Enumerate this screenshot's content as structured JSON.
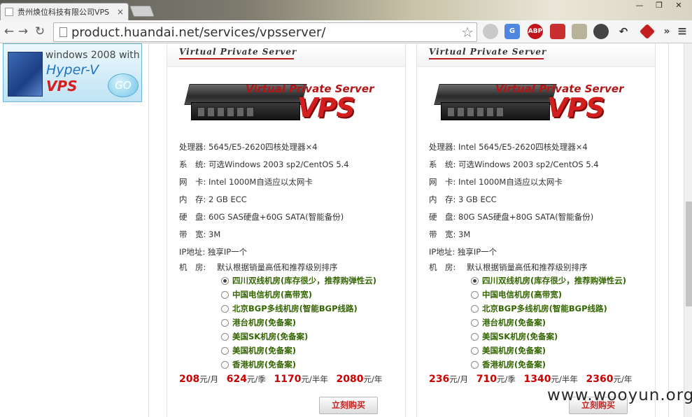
{
  "browser": {
    "tab_title": "贵州焕位科技有限公司VPS",
    "tab_close": "×",
    "url": "product.huandai.net/services/vpsserver/",
    "extensions": [
      "ABP"
    ]
  },
  "ad": {
    "line1": "windows 2008 with",
    "line2": "Hyper-V",
    "line3": "VPS",
    "go": "GO"
  },
  "cards": [
    {
      "header": "Virtual Private Server",
      "banner_text": "Virtual Private Server",
      "banner_vps": "VPS",
      "cpu": "处理器: 5645/E5-2620四核处理器×4",
      "os": "系　统: 可选Windows 2003 sp2/CentOS 5.4",
      "nic": "网　卡: Intel 1000M自适应以太网卡",
      "ram": "内　存: 2 GB ECC",
      "disk": "硬　盘: 60G SAS硬盘+60G SATA(智能备份)",
      "bandwidth": "带　宽: 3M",
      "ip": "IP地址: 独享IP一个",
      "room_label": "机　房:",
      "room_note": "默认根据销量高低和推荐级别排序",
      "rooms": [
        "四川双线机房(库存很少，推荐购弹性云)",
        "中国电信机房(高带宽)",
        "北京BGP多线机房(智能BGP线路)",
        "港台机房(免备案)",
        "美国SK机房(免备案)",
        "美国机房(免备案)",
        "香港机房(免备案)"
      ],
      "selected_room": 0,
      "prices": [
        {
          "value": "208",
          "unit": "元/月"
        },
        {
          "value": "624",
          "unit": "元/季"
        },
        {
          "value": "1170",
          "unit": "元/半年"
        },
        {
          "value": "2080",
          "unit": "元/年"
        }
      ],
      "buy_label": "立刻购买"
    },
    {
      "header": "Virtual Private Server",
      "banner_text": "Virtual Private Server",
      "banner_vps": "VPS",
      "cpu": "处理器: Intel 5645/E5-2620四核处理器×4",
      "os": "系　统: 可选Windows 2003 sp2/CentOS 5.4",
      "nic": "网　卡: Intel 1000M自适应以太网卡",
      "ram": "内　存: 3 GB ECC",
      "disk": "硬　盘: 80G SAS硬盘+80G SATA(智能备份)",
      "bandwidth": "带　宽: 3M",
      "ip": "IP地址: 独享IP一个",
      "room_label": "机　房:",
      "room_note": "默认根据销量高低和推荐级别排序",
      "rooms": [
        "四川双线机房(库存很少，推荐购弹性云)",
        "中国电信机房(高带宽)",
        "北京BGP多线机房(智能BGP线路)",
        "港台机房(免备案)",
        "美国SK机房(免备案)",
        "美国机房(免备案)",
        "香港机房(免备案)"
      ],
      "selected_room": 0,
      "prices": [
        {
          "value": "236",
          "unit": "元/月"
        },
        {
          "value": "710",
          "unit": "元/季"
        },
        {
          "value": "1340",
          "unit": "元/半年"
        },
        {
          "value": "2360",
          "unit": "元/年"
        }
      ],
      "buy_label": "立刻购买"
    }
  ],
  "watermark": "www.wooyun.org"
}
